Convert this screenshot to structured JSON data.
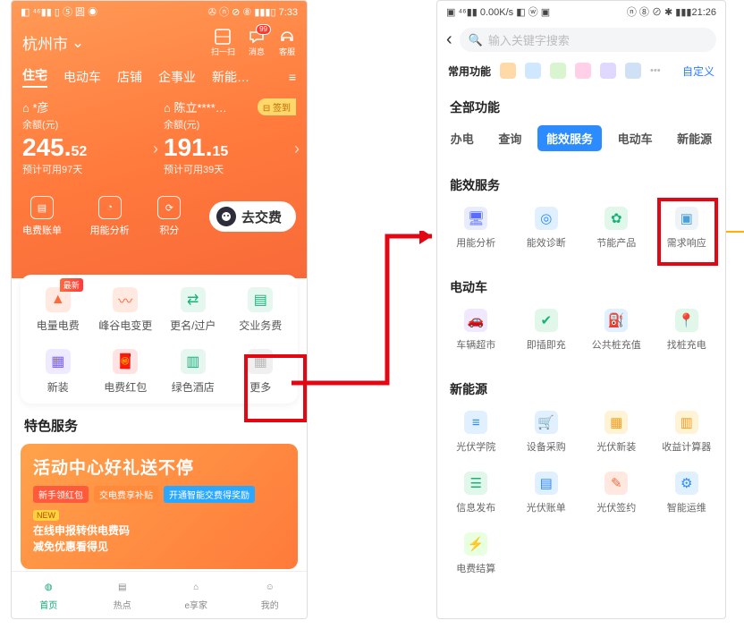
{
  "left": {
    "statusbar": {
      "left": "◧ ⁴⁶▮▮ ▯ ⑤ 圆 ◉",
      "right": "✇ ⓝ ⊘ ⑧ ▮▮▮▯ 7:33"
    },
    "location": "杭州市",
    "header_icons": [
      {
        "label": "扫一扫"
      },
      {
        "label": "消息",
        "badge": "99"
      },
      {
        "label": "客服"
      }
    ],
    "tabs": [
      "住宅",
      "电动车",
      "店铺",
      "企事业",
      "新能…"
    ],
    "accounts": [
      {
        "owner": "*彦",
        "sub": "余额(元)",
        "int": "245.",
        "dec": "52",
        "est": "预计可用97天"
      },
      {
        "owner": "陈立****…",
        "sub": "余额(元)",
        "int": "191.",
        "dec": "15",
        "est": "预计可用39天",
        "sign": "⊟ 签到"
      }
    ],
    "quick": [
      {
        "label": "电费账单"
      },
      {
        "label": "用能分析"
      },
      {
        "label": "积分"
      }
    ],
    "pay": "去交费",
    "grid": [
      {
        "label": "电量电费",
        "new": "最新"
      },
      {
        "label": "峰谷电变更"
      },
      {
        "label": "更名/过户"
      },
      {
        "label": "交业务费"
      },
      {
        "label": "新装"
      },
      {
        "label": "电费红包"
      },
      {
        "label": "绿色酒店"
      },
      {
        "label": "更多"
      }
    ],
    "special": "特色服务",
    "banner": {
      "title": "活动中心好礼送不停",
      "pills": [
        "新手领红包",
        "交电费享补贴",
        "开通智能交费得奖励"
      ],
      "new": "NEW",
      "line1": "在线申报转供电费码",
      "line2": "减免优惠看得见"
    },
    "tabbar": [
      {
        "label": "首页"
      },
      {
        "label": "热点"
      },
      {
        "label": "e享家"
      },
      {
        "label": "我的"
      }
    ]
  },
  "right": {
    "statusbar": {
      "left": "▣ ⁴⁶▮▮ 0.00K/s ◧ ⓦ ▣",
      "right": "ⓝ ⑧ ⊘ ✱ ▮▮▮21:26"
    },
    "search_placeholder": "输入关键字搜索",
    "fav_label": "常用功能",
    "custom": "自定义",
    "all_label": "全部功能",
    "tabs": [
      "办电",
      "查询",
      "能效服务",
      "电动车",
      "新能源"
    ],
    "sections": [
      {
        "title": "能效服务",
        "items": [
          "用能分析",
          "能效诊断",
          "节能产品",
          "需求响应"
        ]
      },
      {
        "title": "电动车",
        "items": [
          "车辆超市",
          "即插即充",
          "公共桩充值",
          "找桩充电"
        ]
      },
      {
        "title": "新能源",
        "items": [
          "光伏学院",
          "设备采购",
          "光伏新装",
          "收益计算器",
          "信息发布",
          "光伏账单",
          "光伏签约",
          "智能运维",
          "电费结算"
        ]
      }
    ]
  }
}
